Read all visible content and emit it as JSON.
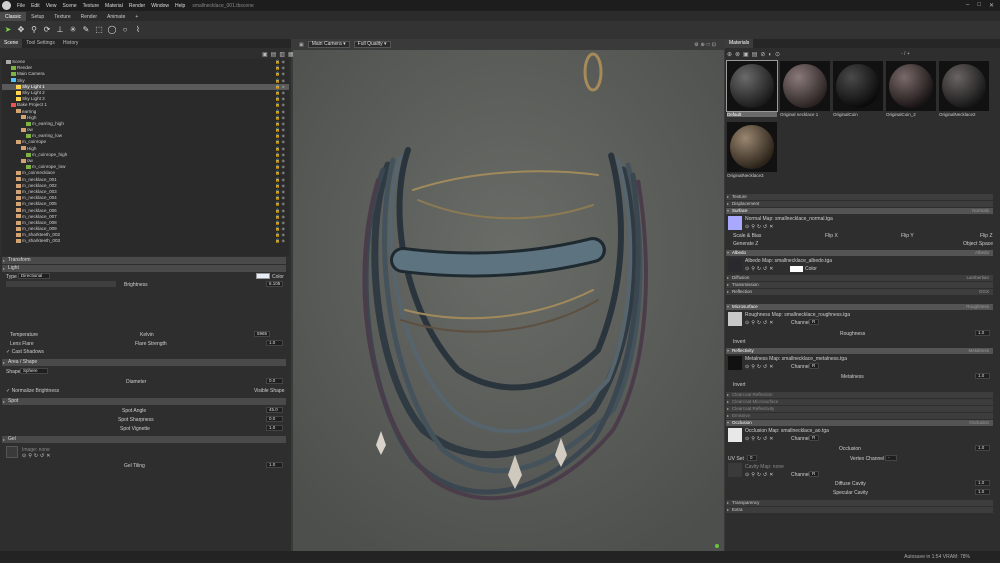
{
  "titlebar": {
    "menus": [
      "File",
      "Edit",
      "View",
      "Scene",
      "Texture",
      "Material",
      "Render",
      "Window",
      "Help"
    ],
    "doc_title": "smallnecklace_001.tbscene",
    "win_controls": [
      "–",
      "□",
      "✕"
    ]
  },
  "modes": [
    "Classic",
    "Setup",
    "Texture",
    "Render",
    "Animate",
    "+"
  ],
  "left_tabs": [
    "Scene",
    "Tool Settings",
    "History"
  ],
  "scene_tree": [
    {
      "label": "Scene",
      "depth": 0,
      "color": "#aaaaaa"
    },
    {
      "label": "Render",
      "depth": 1,
      "color": "#7cb342"
    },
    {
      "label": "Main Camera",
      "depth": 1,
      "color": "#7cb342"
    },
    {
      "label": "Sky",
      "depth": 1,
      "color": "#4fc3f7"
    },
    {
      "label": "Sky Light 1",
      "depth": 2,
      "color": "#ffd54f",
      "selected": true
    },
    {
      "label": "Sky Light 2",
      "depth": 2,
      "color": "#ffd54f"
    },
    {
      "label": "Sky Light 3",
      "depth": 2,
      "color": "#ffd54f"
    },
    {
      "label": "Bake Project 1",
      "depth": 1,
      "color": "#ef5350"
    },
    {
      "label": "earring",
      "depth": 2,
      "color": "#d4a373"
    },
    {
      "label": "High",
      "depth": 3,
      "color": "#d4a373"
    },
    {
      "label": "m_earring_high",
      "depth": 4,
      "color": "#7cb342"
    },
    {
      "label": "ow",
      "depth": 3,
      "color": "#d4a373"
    },
    {
      "label": "m_earring_low",
      "depth": 4,
      "color": "#7cb342"
    },
    {
      "label": "m_coinrope",
      "depth": 2,
      "color": "#d4a373"
    },
    {
      "label": "High",
      "depth": 3,
      "color": "#d4a373"
    },
    {
      "label": "m_coinrope_high",
      "depth": 4,
      "color": "#7cb342"
    },
    {
      "label": "ow",
      "depth": 3,
      "color": "#d4a373"
    },
    {
      "label": "m_coinrope_low",
      "depth": 4,
      "color": "#7cb342"
    },
    {
      "label": "m_coinnecklace",
      "depth": 2,
      "color": "#d4a373"
    },
    {
      "label": "m_necklace_001",
      "depth": 2,
      "color": "#d4a373"
    },
    {
      "label": "m_necklace_002",
      "depth": 2,
      "color": "#d4a373"
    },
    {
      "label": "m_necklace_003",
      "depth": 2,
      "color": "#d4a373"
    },
    {
      "label": "m_necklace_004",
      "depth": 2,
      "color": "#d4a373"
    },
    {
      "label": "m_necklace_005",
      "depth": 2,
      "color": "#d4a373"
    },
    {
      "label": "m_necklace_006",
      "depth": 2,
      "color": "#d4a373"
    },
    {
      "label": "m_necklace_007",
      "depth": 2,
      "color": "#d4a373"
    },
    {
      "label": "m_necklace_008",
      "depth": 2,
      "color": "#d4a373"
    },
    {
      "label": "m_necklace_009",
      "depth": 2,
      "color": "#d4a373"
    },
    {
      "label": "m_sharkteeth_002",
      "depth": 2,
      "color": "#d4a373"
    },
    {
      "label": "m_sharkteeth_003",
      "depth": 2,
      "color": "#d4a373"
    }
  ],
  "props": {
    "transform": "Transform",
    "light": "Light",
    "type_label": "Type",
    "type_value": "Directional",
    "color_label": "Color",
    "brightness_label": "Brightness",
    "brightness_value": "6.105",
    "temperature_label": "Temperature",
    "kelvin_label": "Kelvin",
    "kelvin_value": "5965",
    "lens_flare_label": "Lens Flare",
    "flare_strength_label": "Flare Strength",
    "flare_strength_value": "1.0",
    "cast_shadows_label": "Cast Shadows",
    "area_shape": "Area / Shape",
    "shape_label": "Shape",
    "shape_value": "Sphere",
    "diameter_label": "Diameter",
    "diameter_value": "0.0",
    "normalize_label": "Normalize Brightness",
    "visible_shape_label": "Visible Shape",
    "spot": "Spot",
    "spot_angle_label": "Spot Angle",
    "spot_angle_value": "45.0",
    "spot_sharpness_label": "Spot Sharpness",
    "spot_sharpness_value": "0.0",
    "spot_vignette_label": "Spot Vignette",
    "spot_vignette_value": "1.0",
    "gel": "Gel",
    "image_label": "Image: none",
    "gel_tiling_label": "Gel Tiling",
    "gel_tiling_value": "1.0"
  },
  "viewport": {
    "camera": "Main Camera",
    "quality": "Full Quality"
  },
  "materials": {
    "title": "Materials",
    "page": "- / +",
    "items": [
      {
        "name": "Default",
        "selected": true,
        "colors": [
          "#6a6a6a",
          "#1a1a1a"
        ]
      },
      {
        "name": "Original necklace 1",
        "colors": [
          "#8a7a7a",
          "#2a2222"
        ]
      },
      {
        "name": "OriginalCoin",
        "colors": [
          "#4a4a4a",
          "#0a0a0a"
        ]
      },
      {
        "name": "OriginalCoin_2",
        "colors": [
          "#7a6a6a",
          "#1a1414"
        ]
      },
      {
        "name": "OriginalNecklace2",
        "colors": [
          "#6a6464",
          "#161616"
        ]
      },
      {
        "name": "OriginalNecklace3",
        "colors": [
          "#9a8670",
          "#2a2218"
        ]
      }
    ]
  },
  "mat_props": {
    "texture": "Texture",
    "displacement": "Displacement",
    "surface": "Surface",
    "surface_val": "Normals",
    "normal_map": "Normal Map: smallnecklace_normal.tga",
    "scale_bias": "Scale & Bias",
    "flip_x": "Flip X",
    "flip_y": "Flip Y",
    "flip_z": "Flip Z",
    "generate_z": "Generate Z",
    "object_space": "Object Space",
    "albedo": "Albedo",
    "albedo_val": "Albedo",
    "albedo_map": "Albedo Map: smallnecklace_albedo.tga",
    "color_label": "Color",
    "diffusion": "Diffusion",
    "diffusion_val": "Lambertian",
    "transmission": "Transmission",
    "reflection": "Reflection",
    "reflection_val": "GGX",
    "microsurface": "Microsurface",
    "microsurface_val": "Roughness",
    "roughness_map": "Roughness Map: smallnecklace_roughness.tga",
    "channel_label": "Channel",
    "channel_r": "R",
    "roughness_label": "Roughness",
    "roughness_value": "1.0",
    "invert_label": "Invert",
    "reflectivity": "Reflectivity",
    "reflectivity_val": "Metalness",
    "metalness_map": "Metalness Map: smallnecklace_metalness.tga",
    "metalness_label": "Metalness",
    "metalness_value": "1.0",
    "clearcoat_reflection": "Clearcoat Reflection",
    "clearcoat_micro": "Clearcoat Microsurface",
    "clearcoat_refl": "Clearcoat Reflectivity",
    "emissive": "Emissive",
    "occlusion": "Occlusion",
    "occlusion_val": "Occlusion",
    "occlusion_map": "Occlusion Map: smallnecklace_ao.tga",
    "occlusion_label": "Occlusion",
    "occlusion_value": "1.0",
    "uv_set_label": "UV Set",
    "uv_set_value": "0",
    "vertex_channel_label": "Vertex Channel",
    "vertex_channel_value": "-",
    "cavity_map": "Cavity Map: none",
    "diffuse_cavity_label": "Diffuse Cavity",
    "diffuse_cavity_value": "1.0",
    "specular_cavity_label": "Specular Cavity",
    "specular_cavity_value": "1.0",
    "transparency": "Transparency",
    "extra": "Extra"
  },
  "status": {
    "left": "",
    "right": "Autosave in 1:54   VRAM: 78%"
  }
}
